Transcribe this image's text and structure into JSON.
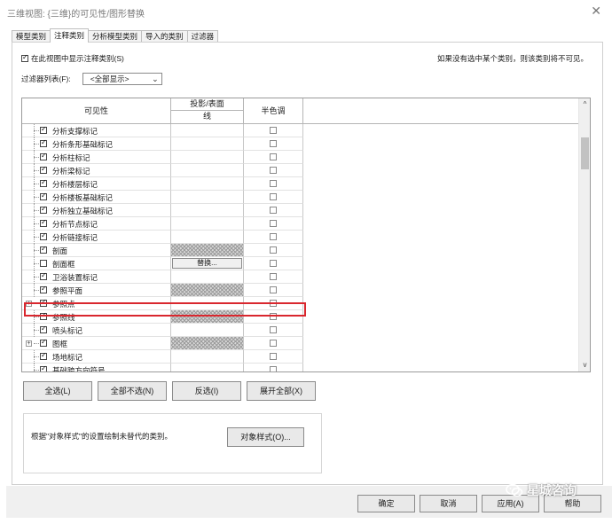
{
  "window": {
    "title": "三维视图: {三维}的可见性/图形替换",
    "close_glyph": "✕"
  },
  "tabs": [
    {
      "label": "模型类别",
      "active": false
    },
    {
      "label": "注释类别",
      "active": true
    },
    {
      "label": "分析模型类别",
      "active": false
    },
    {
      "label": "导入的类别",
      "active": false
    },
    {
      "label": "过滤器",
      "active": false
    }
  ],
  "options": {
    "show_annotations_label": "在此视图中显示注释类别(S)",
    "show_annotations_checked": true,
    "note": "如果没有选中某个类别，则该类别将不可见。",
    "filter_label": "过滤器列表(F):",
    "filter_value": "<全部显示>"
  },
  "grid": {
    "headers": {
      "visibility": "可见性",
      "projection": "投影/表面",
      "line": "线",
      "halftone": "半色调"
    },
    "rows": [
      {
        "label": "分析支撑标记",
        "checked": true,
        "expand": false,
        "line": "empty",
        "halftone": false
      },
      {
        "label": "分析条形基础标记",
        "checked": true,
        "expand": false,
        "line": "empty",
        "halftone": false
      },
      {
        "label": "分析柱标记",
        "checked": true,
        "expand": false,
        "line": "empty",
        "halftone": false
      },
      {
        "label": "分析梁标记",
        "checked": true,
        "expand": false,
        "line": "empty",
        "halftone": false
      },
      {
        "label": "分析楼层标记",
        "checked": true,
        "expand": false,
        "line": "empty",
        "halftone": false
      },
      {
        "label": "分析楼板基础标记",
        "checked": true,
        "expand": false,
        "line": "empty",
        "halftone": false
      },
      {
        "label": "分析独立基础标记",
        "checked": true,
        "expand": false,
        "line": "empty",
        "halftone": false
      },
      {
        "label": "分析节点标记",
        "checked": true,
        "expand": false,
        "line": "empty",
        "halftone": false
      },
      {
        "label": "分析链接标记",
        "checked": true,
        "expand": false,
        "line": "empty",
        "halftone": false
      },
      {
        "label": "剖面",
        "checked": true,
        "expand": false,
        "line": "hatch",
        "halftone": false
      },
      {
        "label": "剖面框",
        "checked": false,
        "expand": false,
        "line": "override",
        "halftone": false,
        "selected": true
      },
      {
        "label": "卫浴装置标记",
        "checked": true,
        "expand": false,
        "line": "empty",
        "halftone": false
      },
      {
        "label": "参照平面",
        "checked": true,
        "expand": false,
        "line": "hatch",
        "halftone": false
      },
      {
        "label": "参照点",
        "checked": true,
        "expand": true,
        "line": "empty",
        "halftone": false
      },
      {
        "label": "参照线",
        "checked": true,
        "expand": false,
        "line": "hatch",
        "halftone": false
      },
      {
        "label": "喷头标记",
        "checked": true,
        "expand": false,
        "line": "empty",
        "halftone": false
      },
      {
        "label": "图框",
        "checked": true,
        "expand": true,
        "line": "hatch",
        "halftone": false
      },
      {
        "label": "场地标记",
        "checked": true,
        "expand": false,
        "line": "empty",
        "halftone": false
      },
      {
        "label": "基础跨方向符号",
        "checked": true,
        "expand": false,
        "line": "empty",
        "halftone": false
      }
    ],
    "override_label": "替换...",
    "scroll_up": "^",
    "scroll_down": "v"
  },
  "grid_buttons": {
    "select_all": "全选(L)",
    "select_none": "全部不选(N)",
    "invert": "反选(I)",
    "expand_all": "展开全部(X)"
  },
  "info": {
    "text": "根据\"对象样式\"的设置绘制未替代的类别。",
    "object_styles_button": "对象样式(O)..."
  },
  "footer": {
    "ok": "确定",
    "cancel": "取消",
    "apply": "应用(A)",
    "help": "帮助"
  },
  "watermark": {
    "text": "星城咨询",
    "icon": "wechat-icon"
  },
  "colors": {
    "highlight": "#d9272e",
    "panel_border": "#cfcfcf",
    "footer_bg": "#f0f0f0"
  }
}
